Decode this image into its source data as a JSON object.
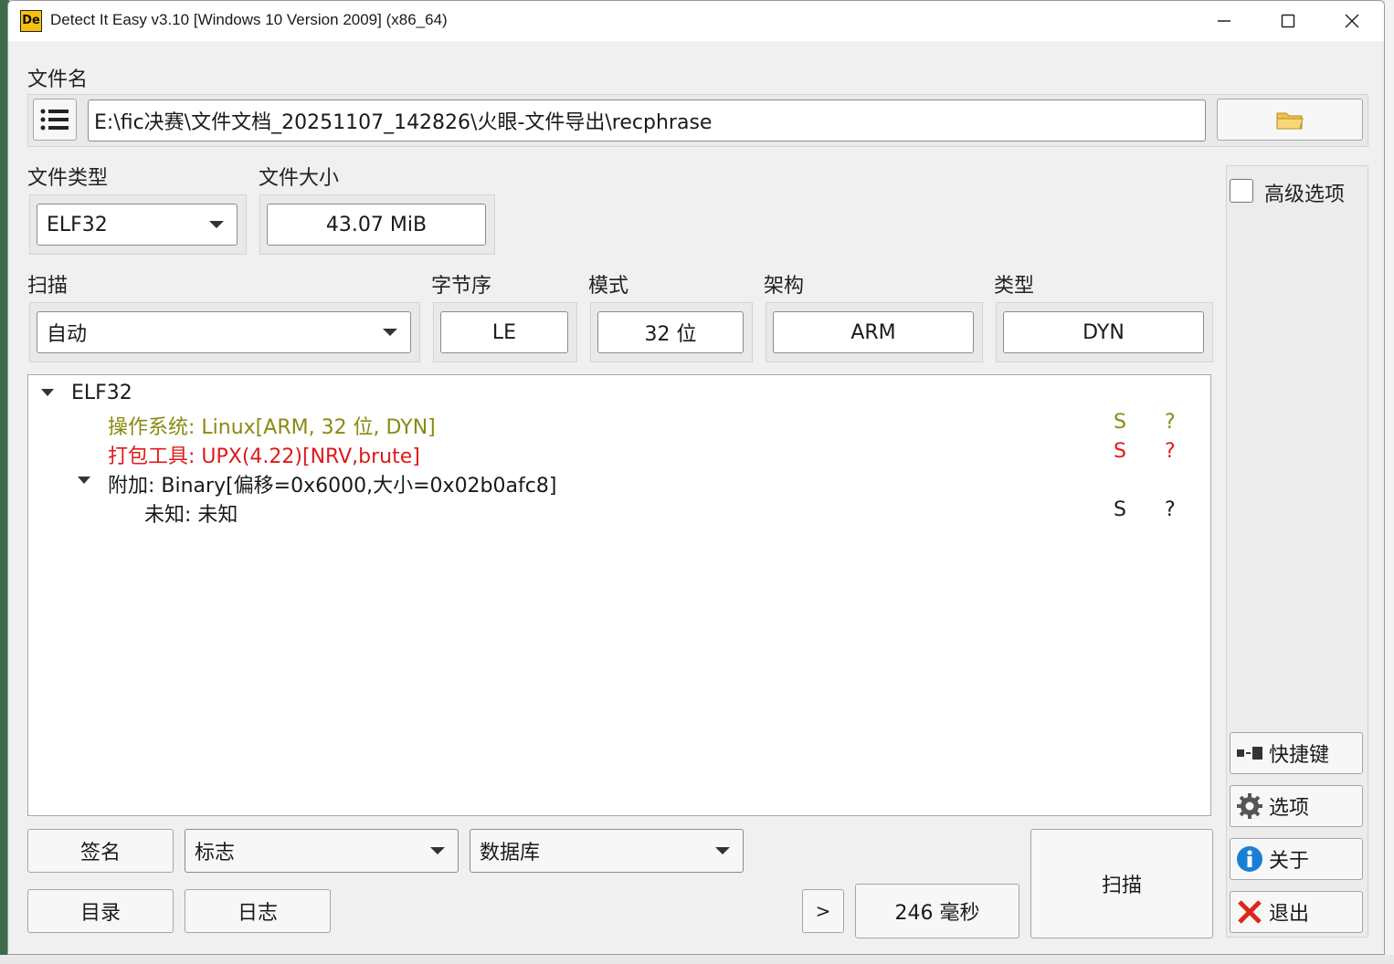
{
  "window": {
    "title": "Detect It Easy v3.10 [Windows 10 Version 2009] (x86_64)",
    "app_icon_text": "De"
  },
  "file": {
    "label": "文件名",
    "path": "E:\\fic决赛\\文件文档_20251107_142826\\火眼-文件导出\\recphrase"
  },
  "file_type": {
    "label": "文件类型",
    "value": "ELF32"
  },
  "file_size": {
    "label": "文件大小",
    "value": "43.07 MiB"
  },
  "scan": {
    "label": "扫描",
    "value": "自动"
  },
  "endian": {
    "label": "字节序",
    "value": "LE"
  },
  "mode": {
    "label": "模式",
    "value": "32 位"
  },
  "arch": {
    "label": "架构",
    "value": "ARM"
  },
  "type": {
    "label": "类型",
    "value": "DYN"
  },
  "advanced": {
    "label": "高级选项",
    "checked": false
  },
  "results": {
    "root": "ELF32",
    "rows": [
      {
        "text": "操作系统: Linux[ARM, 32 位, DYN]",
        "s": "S",
        "q": "?",
        "color": "#8a8a12"
      },
      {
        "text": "打包工具: UPX(4.22)[NRV,brute]",
        "s": "S",
        "q": "?",
        "color": "#e0191b"
      },
      {
        "text": "附加: Binary[偏移=0x6000,大小=0x02b0afc8]",
        "s": "",
        "q": ""
      },
      {
        "text": "未知: 未知",
        "s": "S",
        "q": "?"
      }
    ]
  },
  "bottom": {
    "signature": "签名",
    "flags": "标志",
    "database": "数据库",
    "directory": "目录",
    "log": "日志",
    "more": ">",
    "time": "246 毫秒",
    "scan": "扫描"
  },
  "side": {
    "shortcuts": "快捷键",
    "options": "选项",
    "about": "关于",
    "exit": "退出"
  },
  "icons": [
    "list-icon",
    "folder-icon",
    "shortcut-icon",
    "gear-icon",
    "info-icon",
    "exit-x-icon",
    "minimize-icon",
    "maximize-icon",
    "close-icon"
  ]
}
